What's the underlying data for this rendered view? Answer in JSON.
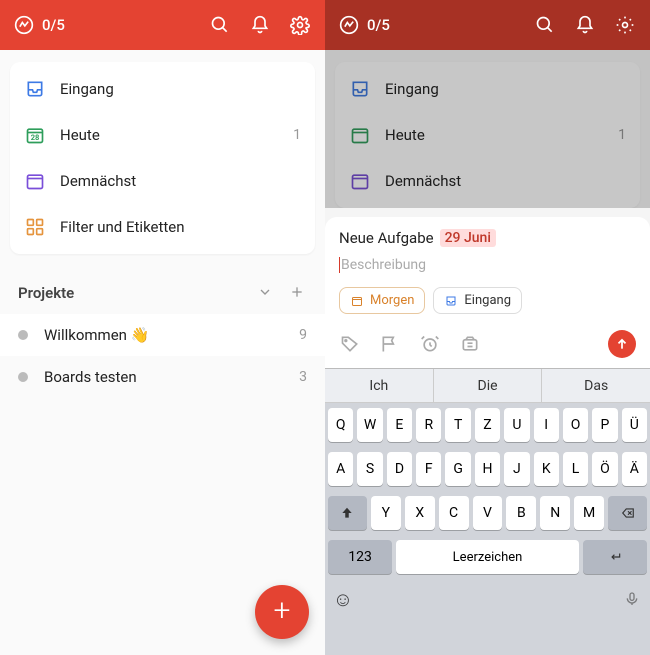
{
  "header": {
    "count": "0/5"
  },
  "nav": {
    "inbox": "Eingang",
    "today": "Heute",
    "today_count": "1",
    "upcoming": "Demnächst",
    "filters": "Filter und Etiketten",
    "today_date": "28"
  },
  "projects_section": "Projekte",
  "projects": [
    {
      "label": "Willkommen 👋",
      "count": "9"
    },
    {
      "label": "Boards testen",
      "count": "3"
    }
  ],
  "quickadd": {
    "title_prefix": "Neue Aufgabe",
    "date_chip": "29 Juni",
    "description_placeholder": "Beschreibung",
    "chip_schedule": "Morgen",
    "chip_project": "Eingang"
  },
  "keyboard": {
    "suggestions": [
      "Ich",
      "Die",
      "Das"
    ],
    "row1": [
      "Q",
      "W",
      "E",
      "R",
      "T",
      "Z",
      "U",
      "I",
      "O",
      "P",
      "Ü"
    ],
    "row2": [
      "A",
      "S",
      "D",
      "F",
      "G",
      "H",
      "J",
      "K",
      "L",
      "Ö",
      "Ä"
    ],
    "row3": [
      "Y",
      "X",
      "C",
      "V",
      "B",
      "N",
      "M"
    ],
    "numkey": "123",
    "space": "Leerzeichen"
  }
}
